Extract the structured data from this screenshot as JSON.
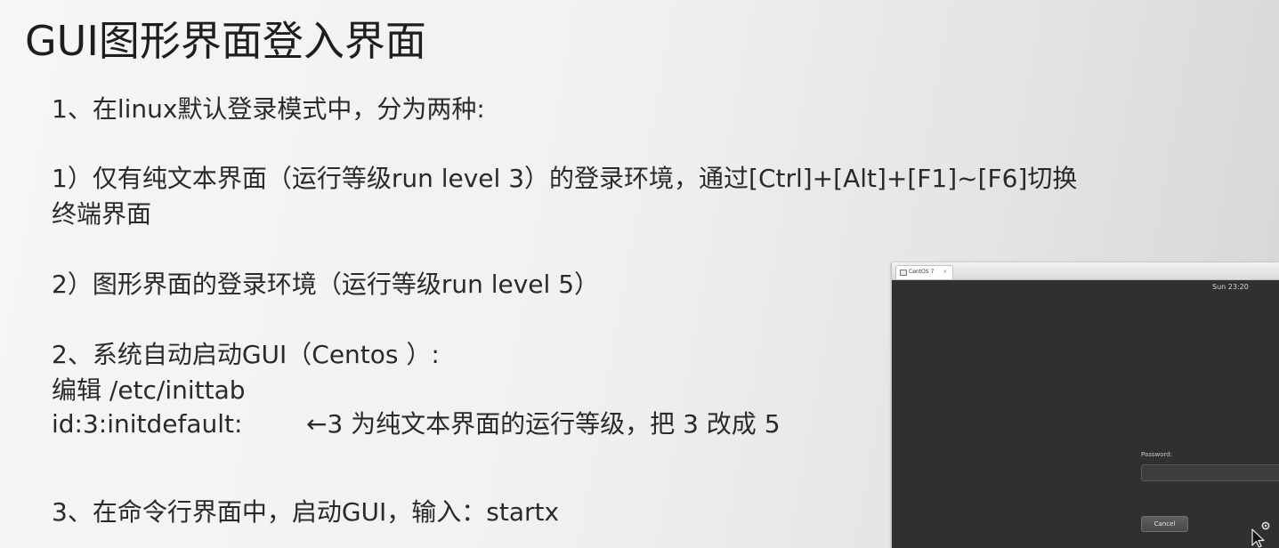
{
  "slide": {
    "title": "GUI图形界面登入界面",
    "lines": {
      "l1": "1、在linux默认登录模式中，分为两种:",
      "l2a": "1）仅有纯文本界面（运行等级run level 3）的登录环境，通过[Ctrl]+[Alt]+[F1]~[F6]切换",
      "l2b": "终端界面",
      "l3": "2）图形界面的登录环境（运行等级run level 5）",
      "l4": "2、系统自动启动GUI（Centos ）:",
      "l5": "编辑 /etc/inittab",
      "l6": "id:3:initdefault:",
      "l6_note": "←3 为纯文本界面的运行等级，把 3 改成 5",
      "l7": "3、在命令行界面中，启动GUI，输入：startx"
    }
  },
  "vm_screenshot": {
    "tab_label": "CentOS 7",
    "clock": "Sun 23:20",
    "password_label": "Password:",
    "cancel_label": "Cancel",
    "icons": [
      "settings-icon",
      "cursor-icon"
    ]
  }
}
